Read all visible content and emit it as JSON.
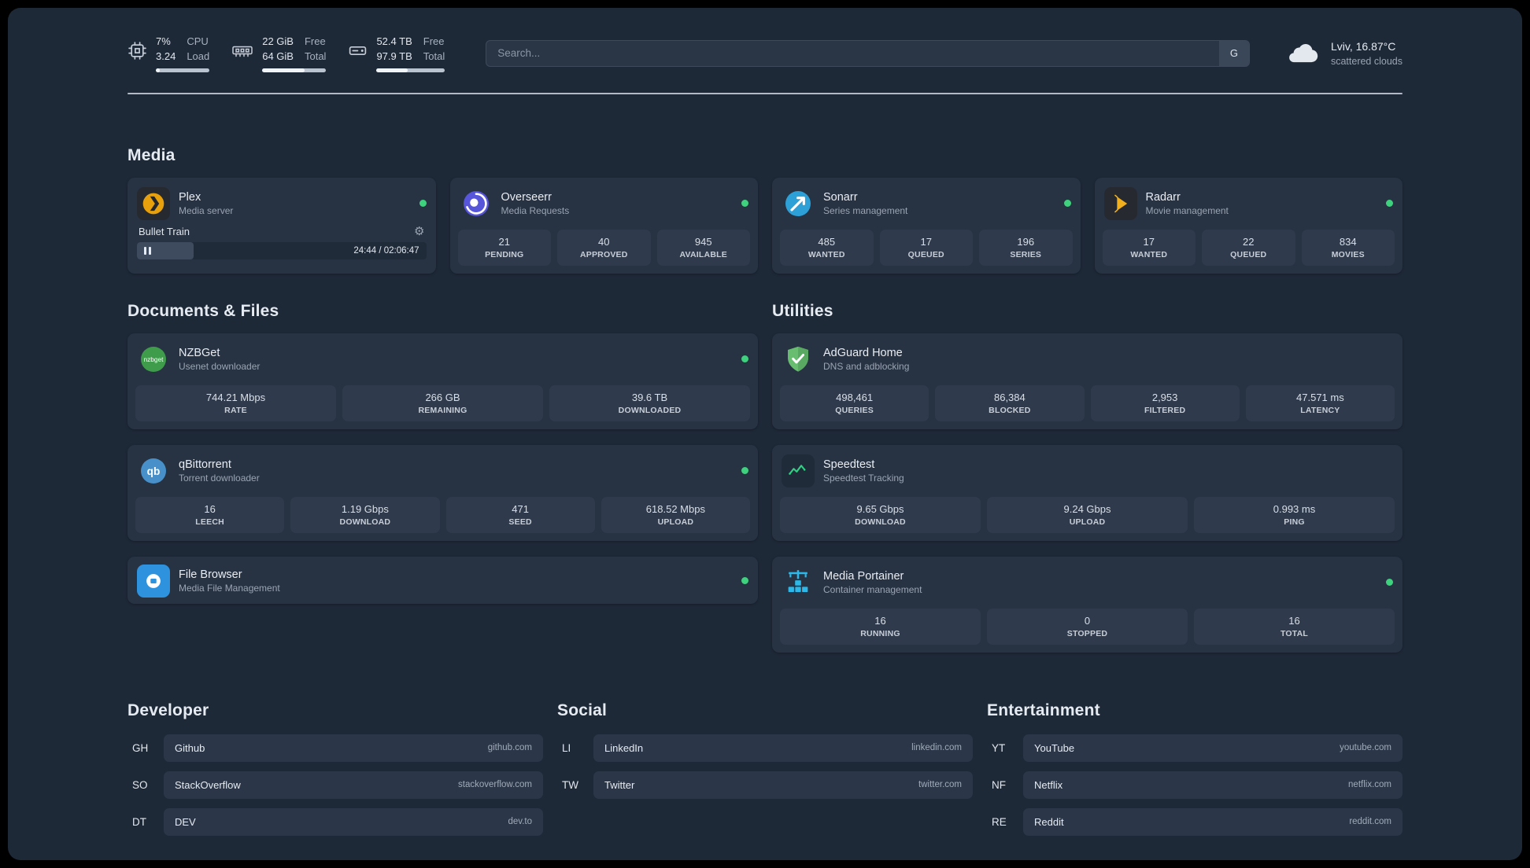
{
  "topbar": {
    "cpu": {
      "values": [
        "7%",
        "3.24"
      ],
      "labels": [
        "CPU",
        "Load"
      ],
      "percent": 7
    },
    "memory": {
      "values": [
        "22 GiB",
        "64 GiB"
      ],
      "labels": [
        "Free",
        "Total"
      ],
      "percent": 66
    },
    "disk": {
      "values": [
        "52.4 TB",
        "97.9 TB"
      ],
      "labels": [
        "Free",
        "Total"
      ],
      "percent": 46
    },
    "search": {
      "placeholder": "Search...",
      "provider_label": "G"
    },
    "weather": {
      "location": "Lviv, 16.87°C",
      "condition": "scattered clouds"
    }
  },
  "sections": {
    "media": {
      "title": "Media",
      "cards": [
        {
          "name": "Plex",
          "subtitle": "Media server",
          "status": "online",
          "player": {
            "track": "Bullet Train",
            "time": "24:44 / 02:06:47",
            "progress_percent": 19.5,
            "state": "paused"
          }
        },
        {
          "name": "Overseerr",
          "subtitle": "Media Requests",
          "status": "online",
          "stats": [
            {
              "value": "21",
              "label": "PENDING"
            },
            {
              "value": "40",
              "label": "APPROVED"
            },
            {
              "value": "945",
              "label": "AVAILABLE"
            }
          ]
        },
        {
          "name": "Sonarr",
          "subtitle": "Series management",
          "status": "online",
          "stats": [
            {
              "value": "485",
              "label": "WANTED"
            },
            {
              "value": "17",
              "label": "QUEUED"
            },
            {
              "value": "196",
              "label": "SERIES"
            }
          ]
        },
        {
          "name": "Radarr",
          "subtitle": "Movie management",
          "status": "online",
          "stats": [
            {
              "value": "17",
              "label": "WANTED"
            },
            {
              "value": "22",
              "label": "QUEUED"
            },
            {
              "value": "834",
              "label": "MOVIES"
            }
          ]
        }
      ]
    },
    "documents": {
      "title": "Documents & Files",
      "cards": [
        {
          "name": "NZBGet",
          "subtitle": "Usenet downloader",
          "status": "online",
          "stats": [
            {
              "value": "744.21 Mbps",
              "label": "RATE"
            },
            {
              "value": "266 GB",
              "label": "REMAINING"
            },
            {
              "value": "39.6 TB",
              "label": "DOWNLOADED"
            }
          ]
        },
        {
          "name": "qBittorrent",
          "subtitle": "Torrent downloader",
          "status": "online",
          "stats": [
            {
              "value": "16",
              "label": "LEECH"
            },
            {
              "value": "1.19 Gbps",
              "label": "DOWNLOAD"
            },
            {
              "value": "471",
              "label": "SEED"
            },
            {
              "value": "618.52 Mbps",
              "label": "UPLOAD"
            }
          ]
        },
        {
          "name": "File Browser",
          "subtitle": "Media File Management",
          "status": "online",
          "stats": []
        }
      ]
    },
    "utilities": {
      "title": "Utilities",
      "cards": [
        {
          "name": "AdGuard Home",
          "subtitle": "DNS and adblocking",
          "stats": [
            {
              "value": "498,461",
              "label": "QUERIES"
            },
            {
              "value": "86,384",
              "label": "BLOCKED"
            },
            {
              "value": "2,953",
              "label": "FILTERED"
            },
            {
              "value": "47.571 ms",
              "label": "LATENCY"
            }
          ]
        },
        {
          "name": "Speedtest",
          "subtitle": "Speedtest Tracking",
          "stats": [
            {
              "value": "9.65 Gbps",
              "label": "DOWNLOAD"
            },
            {
              "value": "9.24 Gbps",
              "label": "UPLOAD"
            },
            {
              "value": "0.993 ms",
              "label": "PING"
            }
          ]
        },
        {
          "name": "Media Portainer",
          "subtitle": "Container management",
          "status": "online",
          "stats": [
            {
              "value": "16",
              "label": "RUNNING"
            },
            {
              "value": "0",
              "label": "STOPPED"
            },
            {
              "value": "16",
              "label": "TOTAL"
            }
          ]
        }
      ]
    }
  },
  "bookmarks": [
    {
      "title": "Developer",
      "items": [
        {
          "abbr": "GH",
          "name": "Github",
          "domain": "github.com"
        },
        {
          "abbr": "SO",
          "name": "StackOverflow",
          "domain": "stackoverflow.com"
        },
        {
          "abbr": "DT",
          "name": "DEV",
          "domain": "dev.to"
        }
      ]
    },
    {
      "title": "Social",
      "items": [
        {
          "abbr": "LI",
          "name": "LinkedIn",
          "domain": "linkedin.com"
        },
        {
          "abbr": "TW",
          "name": "Twitter",
          "domain": "twitter.com"
        }
      ]
    },
    {
      "title": "Entertainment",
      "items": [
        {
          "abbr": "YT",
          "name": "YouTube",
          "domain": "youtube.com"
        },
        {
          "abbr": "NF",
          "name": "Netflix",
          "domain": "netflix.com"
        },
        {
          "abbr": "RE",
          "name": "Reddit",
          "domain": "reddit.com"
        }
      ]
    }
  ],
  "icons": {
    "gear": "⚙",
    "nzbget_label": "nzbget",
    "qbittorrent_label": "qb"
  },
  "colors": {
    "status_online": "#3ed17e",
    "plex_amber": "#e8a00c",
    "overseerr_purple": "#5755d9",
    "sonarr_blue": "#2da0d7",
    "radarr_amber": "#f2b01e",
    "nzbget_green": "#3e9c4b",
    "qbittorrent_blue": "#4790c9",
    "filebrowser_blue": "#2e92df",
    "adguard_green": "#68bd71",
    "speedtest_green": "#2fd283",
    "portainer_blue": "#2cb8e8"
  }
}
